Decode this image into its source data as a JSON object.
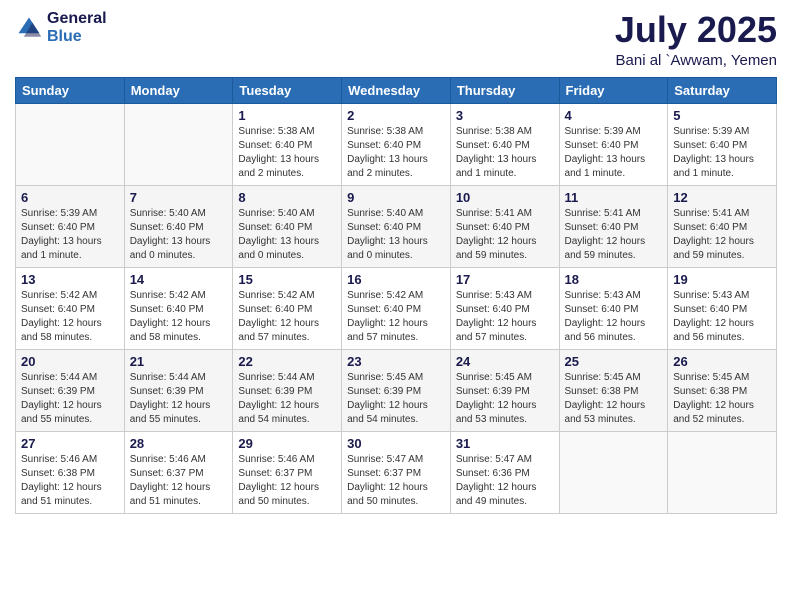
{
  "logo": {
    "general": "General",
    "blue": "Blue"
  },
  "title": "July 2025",
  "subtitle": "Bani al `Awwam, Yemen",
  "headers": [
    "Sunday",
    "Monday",
    "Tuesday",
    "Wednesday",
    "Thursday",
    "Friday",
    "Saturday"
  ],
  "weeks": [
    [
      {
        "num": "",
        "info": ""
      },
      {
        "num": "",
        "info": ""
      },
      {
        "num": "1",
        "info": "Sunrise: 5:38 AM\nSunset: 6:40 PM\nDaylight: 13 hours\nand 2 minutes."
      },
      {
        "num": "2",
        "info": "Sunrise: 5:38 AM\nSunset: 6:40 PM\nDaylight: 13 hours\nand 2 minutes."
      },
      {
        "num": "3",
        "info": "Sunrise: 5:38 AM\nSunset: 6:40 PM\nDaylight: 13 hours\nand 1 minute."
      },
      {
        "num": "4",
        "info": "Sunrise: 5:39 AM\nSunset: 6:40 PM\nDaylight: 13 hours\nand 1 minute."
      },
      {
        "num": "5",
        "info": "Sunrise: 5:39 AM\nSunset: 6:40 PM\nDaylight: 13 hours\nand 1 minute."
      }
    ],
    [
      {
        "num": "6",
        "info": "Sunrise: 5:39 AM\nSunset: 6:40 PM\nDaylight: 13 hours\nand 1 minute."
      },
      {
        "num": "7",
        "info": "Sunrise: 5:40 AM\nSunset: 6:40 PM\nDaylight: 13 hours\nand 0 minutes."
      },
      {
        "num": "8",
        "info": "Sunrise: 5:40 AM\nSunset: 6:40 PM\nDaylight: 13 hours\nand 0 minutes."
      },
      {
        "num": "9",
        "info": "Sunrise: 5:40 AM\nSunset: 6:40 PM\nDaylight: 13 hours\nand 0 minutes."
      },
      {
        "num": "10",
        "info": "Sunrise: 5:41 AM\nSunset: 6:40 PM\nDaylight: 12 hours\nand 59 minutes."
      },
      {
        "num": "11",
        "info": "Sunrise: 5:41 AM\nSunset: 6:40 PM\nDaylight: 12 hours\nand 59 minutes."
      },
      {
        "num": "12",
        "info": "Sunrise: 5:41 AM\nSunset: 6:40 PM\nDaylight: 12 hours\nand 59 minutes."
      }
    ],
    [
      {
        "num": "13",
        "info": "Sunrise: 5:42 AM\nSunset: 6:40 PM\nDaylight: 12 hours\nand 58 minutes."
      },
      {
        "num": "14",
        "info": "Sunrise: 5:42 AM\nSunset: 6:40 PM\nDaylight: 12 hours\nand 58 minutes."
      },
      {
        "num": "15",
        "info": "Sunrise: 5:42 AM\nSunset: 6:40 PM\nDaylight: 12 hours\nand 57 minutes."
      },
      {
        "num": "16",
        "info": "Sunrise: 5:42 AM\nSunset: 6:40 PM\nDaylight: 12 hours\nand 57 minutes."
      },
      {
        "num": "17",
        "info": "Sunrise: 5:43 AM\nSunset: 6:40 PM\nDaylight: 12 hours\nand 57 minutes."
      },
      {
        "num": "18",
        "info": "Sunrise: 5:43 AM\nSunset: 6:40 PM\nDaylight: 12 hours\nand 56 minutes."
      },
      {
        "num": "19",
        "info": "Sunrise: 5:43 AM\nSunset: 6:40 PM\nDaylight: 12 hours\nand 56 minutes."
      }
    ],
    [
      {
        "num": "20",
        "info": "Sunrise: 5:44 AM\nSunset: 6:39 PM\nDaylight: 12 hours\nand 55 minutes."
      },
      {
        "num": "21",
        "info": "Sunrise: 5:44 AM\nSunset: 6:39 PM\nDaylight: 12 hours\nand 55 minutes."
      },
      {
        "num": "22",
        "info": "Sunrise: 5:44 AM\nSunset: 6:39 PM\nDaylight: 12 hours\nand 54 minutes."
      },
      {
        "num": "23",
        "info": "Sunrise: 5:45 AM\nSunset: 6:39 PM\nDaylight: 12 hours\nand 54 minutes."
      },
      {
        "num": "24",
        "info": "Sunrise: 5:45 AM\nSunset: 6:39 PM\nDaylight: 12 hours\nand 53 minutes."
      },
      {
        "num": "25",
        "info": "Sunrise: 5:45 AM\nSunset: 6:38 PM\nDaylight: 12 hours\nand 53 minutes."
      },
      {
        "num": "26",
        "info": "Sunrise: 5:45 AM\nSunset: 6:38 PM\nDaylight: 12 hours\nand 52 minutes."
      }
    ],
    [
      {
        "num": "27",
        "info": "Sunrise: 5:46 AM\nSunset: 6:38 PM\nDaylight: 12 hours\nand 51 minutes."
      },
      {
        "num": "28",
        "info": "Sunrise: 5:46 AM\nSunset: 6:37 PM\nDaylight: 12 hours\nand 51 minutes."
      },
      {
        "num": "29",
        "info": "Sunrise: 5:46 AM\nSunset: 6:37 PM\nDaylight: 12 hours\nand 50 minutes."
      },
      {
        "num": "30",
        "info": "Sunrise: 5:47 AM\nSunset: 6:37 PM\nDaylight: 12 hours\nand 50 minutes."
      },
      {
        "num": "31",
        "info": "Sunrise: 5:47 AM\nSunset: 6:36 PM\nDaylight: 12 hours\nand 49 minutes."
      },
      {
        "num": "",
        "info": ""
      },
      {
        "num": "",
        "info": ""
      }
    ]
  ]
}
